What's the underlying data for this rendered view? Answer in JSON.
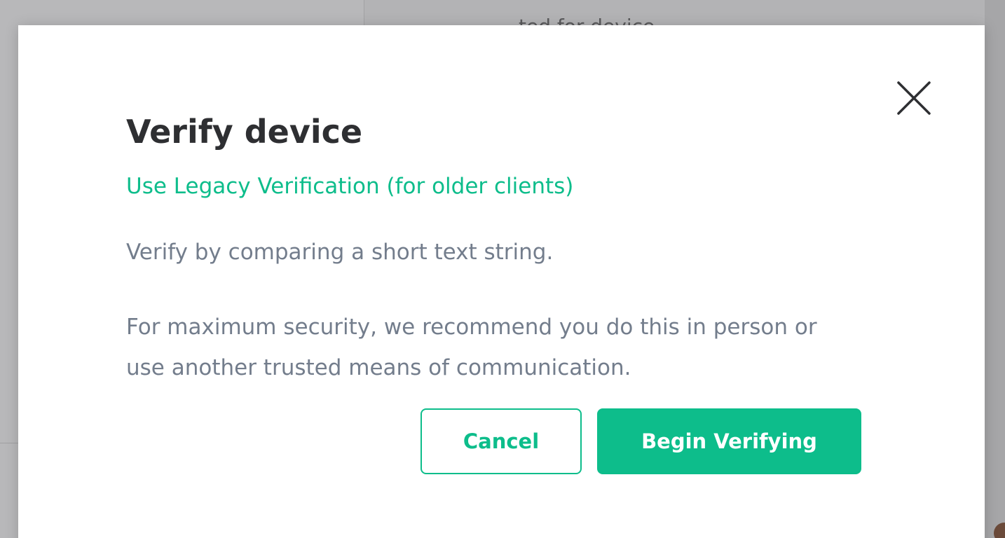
{
  "background": {
    "peek_text": "ted for device"
  },
  "dialog": {
    "title": "Verify device",
    "legacy_link": "Use Legacy Verification (for older clients)",
    "description": "Verify by comparing a short text string.",
    "security_note": "For maximum security, we recommend you do this in person or use another trusted means of communication.",
    "close_icon": "close-icon",
    "buttons": {
      "cancel_label": "Cancel",
      "primary_label": "Begin Verifying"
    }
  },
  "colors": {
    "accent": "#0dbd8b",
    "title_text": "#2e2f32",
    "body_text": "#737d8c",
    "overlay": "#b3b3b5"
  }
}
